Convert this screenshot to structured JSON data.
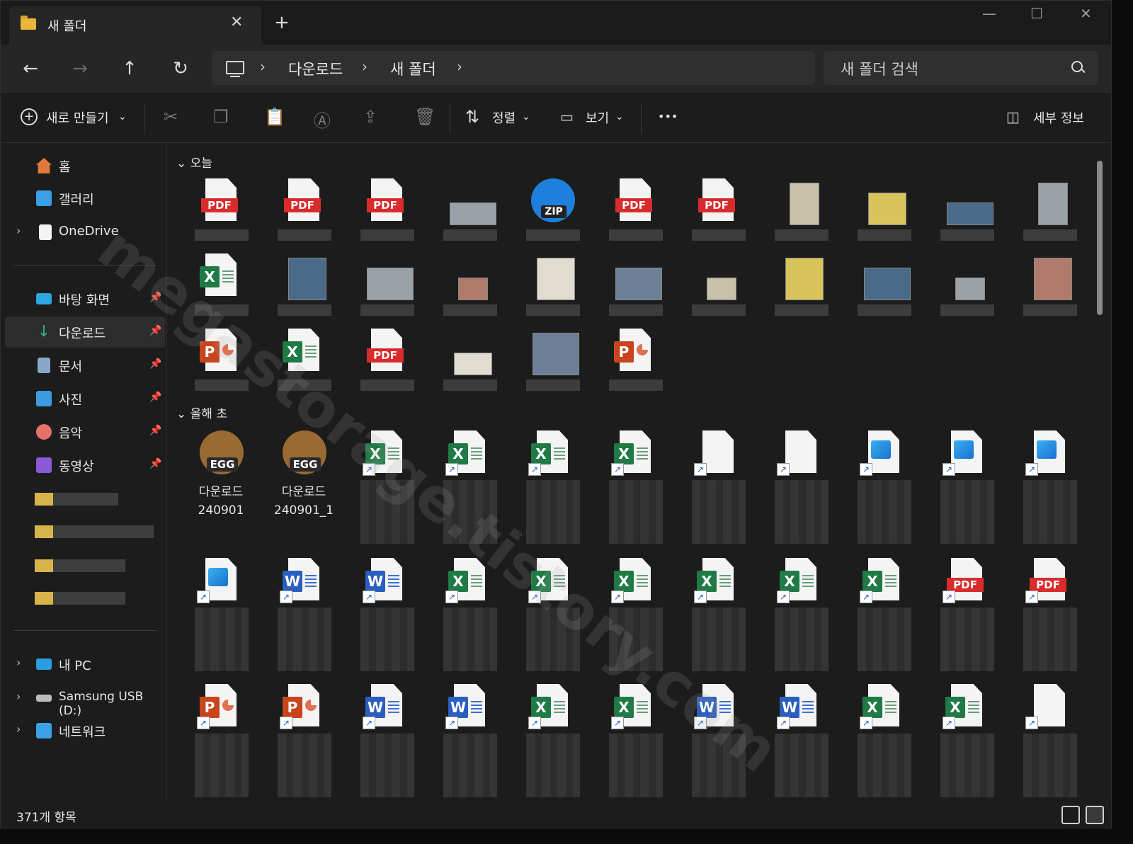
{
  "tab": {
    "title": "새 폴더",
    "close_glyph": "✕",
    "newtab_glyph": "+"
  },
  "window_controls": {
    "minimize": "—",
    "maximize": "☐",
    "close": "✕"
  },
  "nav": {
    "back": "←",
    "forward": "→",
    "up": "↑",
    "refresh": "↻"
  },
  "breadcrumb": {
    "items": [
      "다운로드",
      "새 폴더"
    ],
    "sep": "›"
  },
  "search": {
    "placeholder": "새 폴더 검색"
  },
  "commandbar": {
    "new_label": "새로 만들기",
    "sort_label": "정렬",
    "view_label": "보기",
    "more": "•••",
    "details_label": "세부 정보",
    "icons": [
      "cut-icon",
      "copy-icon",
      "paste-icon",
      "rename-icon",
      "share-icon",
      "delete-icon"
    ]
  },
  "sidebar": {
    "top": [
      {
        "label": "홈",
        "icon": "home-icon",
        "color": "#e07a3a"
      },
      {
        "label": "갤러리",
        "icon": "gallery-icon",
        "color": "#3aa0e8"
      },
      {
        "label": "OneDrive",
        "icon": "onedrive-icon",
        "color": "#f4f4f4"
      }
    ],
    "quick": [
      {
        "label": "바탕 화면",
        "icon": "desktop-icon",
        "color": "#2aa7e0"
      },
      {
        "label": "다운로드",
        "icon": "downloads-icon",
        "color": "#2fb38a"
      },
      {
        "label": "문서",
        "icon": "documents-icon",
        "color": "#8aa6c8"
      },
      {
        "label": "사진",
        "icon": "pictures-icon",
        "color": "#3a9be0"
      },
      {
        "label": "음악",
        "icon": "music-icon",
        "color": "#e8706a"
      },
      {
        "label": "동영상",
        "icon": "videos-icon",
        "color": "#8a5ad8"
      }
    ],
    "devices": [
      {
        "label": "내 PC",
        "icon": "this-pc-icon",
        "color": "#2a9ee0"
      },
      {
        "label": "Samsung USB (D:)",
        "icon": "usb-drive-icon",
        "color": "#bdbdbd"
      },
      {
        "label": "네트워크",
        "icon": "network-icon",
        "color": "#3aa0e8"
      }
    ]
  },
  "groups": {
    "today": "오늘",
    "earlier": "올해 초",
    "chev": "⌄"
  },
  "named_files": [
    {
      "line1": "다운로드",
      "line2": "240901"
    },
    {
      "line1": "다운로드",
      "line2": "240901_1"
    }
  ],
  "badges": {
    "pdf": "PDF",
    "zip": "ZIP",
    "egg": "EGG",
    "x": "X",
    "w": "W",
    "p": "P"
  },
  "status": {
    "count": "371개 항목"
  },
  "watermark": {
    "text": "megastorage.tistory.com"
  }
}
